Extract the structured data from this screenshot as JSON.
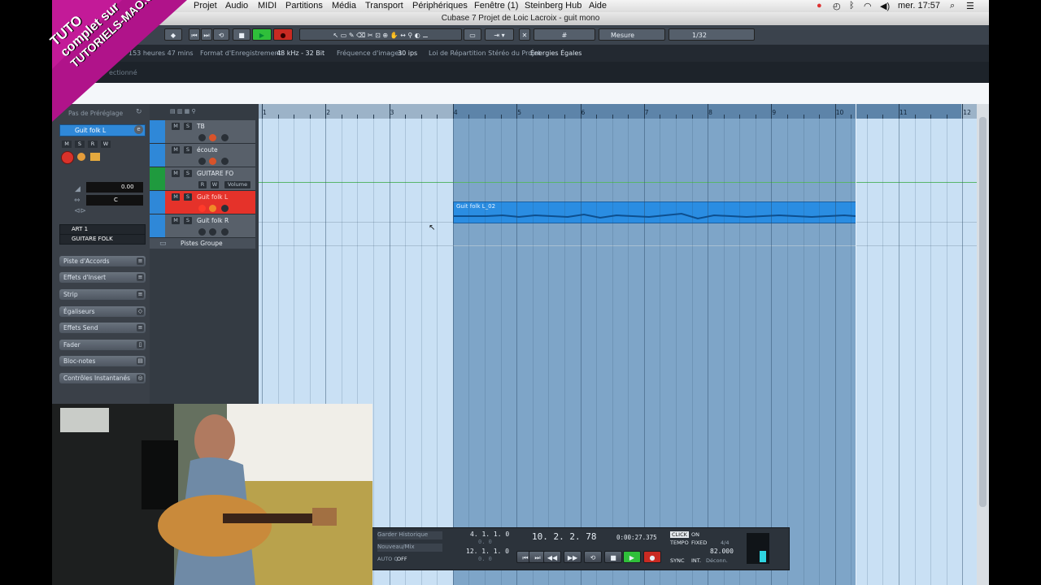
{
  "menubar": {
    "items": [
      "Projet",
      "Audio",
      "MIDI",
      "Partitions",
      "Média",
      "Transport",
      "Périphériques",
      "Fenêtre (1)",
      "Steinberg Hub",
      "Aide"
    ],
    "clock": "mer. 17:57"
  },
  "window": {
    "title": "Cubase 7 Projet de Loic Lacroix - guit mono"
  },
  "toolbar": {
    "snap_type": "Mesure",
    "quantize": "1/32"
  },
  "infoline": {
    "record_time": "153 heures 47 mins",
    "format_label": "Format d'Enregistrement",
    "format_value": "48 kHz - 32 Bit",
    "fps_label": "Fréquence d'images",
    "fps_value": "30 ips",
    "pan_label": "Loi de Répartition Stéréo du Projet",
    "pan_value": "Énergies Égales"
  },
  "selection_line": "ectionné",
  "inspector": {
    "preset_label": "Pas de Préréglage",
    "track_name": "Guit folk L",
    "volume": "0.00",
    "pan": "C",
    "insert_1": "ART 1",
    "insert_2": "GUITARE FOLK",
    "sections": [
      "Piste d'Accords",
      "Effets d'Insert",
      "Strip",
      "Égaliseurs",
      "Effets Send",
      "Fader",
      "Bloc-notes",
      "Contrôles Instantanés"
    ]
  },
  "tracks": [
    {
      "name": "TB",
      "color": "#2f88d8"
    },
    {
      "name": "écoute",
      "color": "#2f88d8"
    },
    {
      "name": "GUITARE FO",
      "color": "#1f9a3e",
      "sub": "Volume"
    },
    {
      "name": "Guit folk L",
      "color": "#e8372c"
    },
    {
      "name": "Guit folk R",
      "color": "#2f88d8"
    }
  ],
  "group_tracks_label": "Pistes Groupe",
  "ruler": {
    "bars": [
      "1",
      "2",
      "3",
      "4",
      "5",
      "6",
      "7",
      "8",
      "9",
      "10",
      "11",
      "12"
    ]
  },
  "event": {
    "label": "Guit folk L_02"
  },
  "transport": {
    "history_label": "Garder Historique",
    "mode_label": "Nouveau/Mix",
    "autoq_label": "AUTO Q",
    "autoq_value": "OFF",
    "left_locator": "4. 1. 1. 0",
    "left_locator_sub": "0.  0",
    "right_locator": "12. 1. 1. 0",
    "right_locator_sub": "0.  0",
    "position_bars": "10. 2. 2. 78",
    "position_time": "0:00:27.375",
    "click_label": "CLICK",
    "click_value": "ON",
    "tempo_label": "TEMPO",
    "tempo_mode": "FIXED",
    "signature": "4/4",
    "tempo_value": "82.000",
    "sync_label": "SYNC",
    "sync_mode": "INT.",
    "sync_state": "Déconn."
  },
  "banner": {
    "line1": "TUTO",
    "line2": "complet sur",
    "line3": "TUTORIELS-MAO.COM"
  },
  "colors": {
    "event_blue": "#2a8de2",
    "record_red": "#e8372c",
    "play_green": "#2fbf3a",
    "cycle_blue": "#7ea5c8"
  }
}
